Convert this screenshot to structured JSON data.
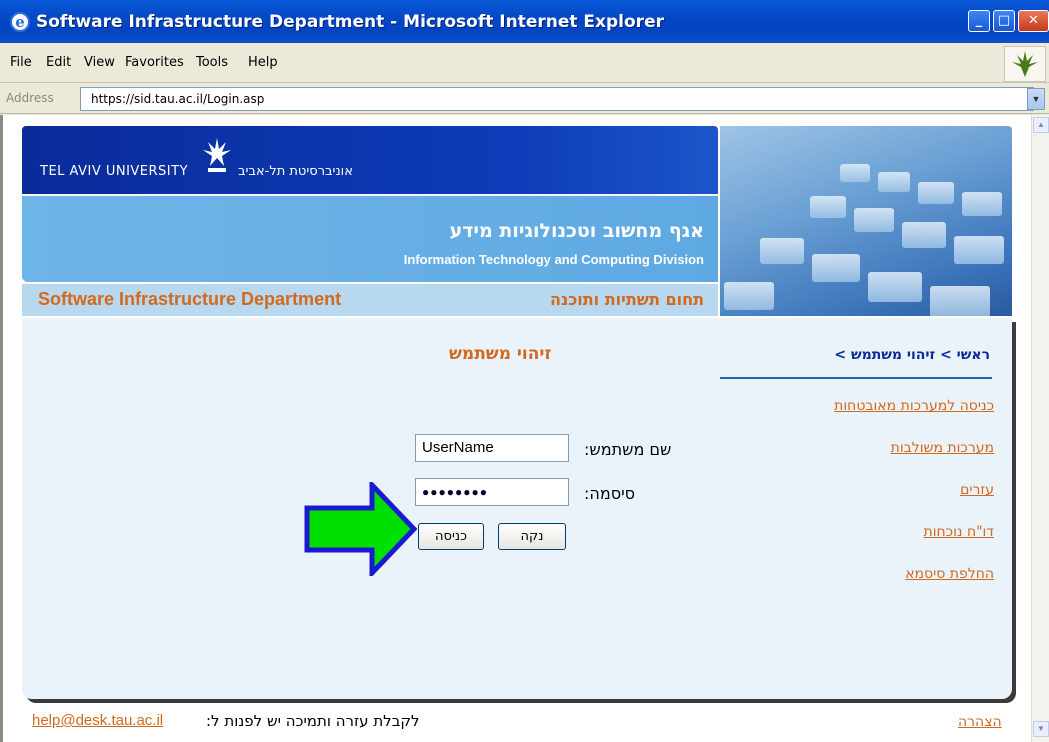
{
  "window": {
    "title": "Software Infrastructure Department - Microsoft Internet Explorer",
    "minimize": "_",
    "maximize": "□",
    "close": "✕"
  },
  "menu": [
    "File",
    "Edit",
    "View",
    "Favorites",
    "Tools",
    "Help"
  ],
  "address": {
    "label": "Address",
    "url": "https://sid.tau.ac.il/Login.asp"
  },
  "banner": {
    "university_en": "TEL AVIV UNIVERSITY",
    "university_he": "אוניברסיטת תל-אביב",
    "division_he": "אגף מחשוב וטכנולוגיות מידע",
    "division_en": "Information Technology and Computing Division",
    "department_en": "Software Infrastructure Department",
    "department_he": "תחום תשתיות ותוכנה"
  },
  "login": {
    "title": "זיהוי משתמש",
    "username_label": "שם משתמש:",
    "username_value": "UserName",
    "password_label": "סיסמה:",
    "password_value": "●●●●●●●●",
    "submit_label": "כניסה",
    "clear_label": "נקה"
  },
  "breadcrumb": "ראשי > זיהוי משתמש >",
  "side_links": [
    "כניסה למערכות מאובטחות",
    "מערכות משולבות",
    "עזרים",
    "דו\"ח נוכחות",
    "החלפת סיסמא"
  ],
  "footer": {
    "text": "לקבלת עזרה ותמיכה יש לפנות ל:",
    "email": "help@desk.tau.ac.il",
    "link": "הצהרה"
  },
  "colors": {
    "accent_orange": "#d2691e",
    "banner_blue": "#0a2b9a",
    "arrow_green": "#00e000",
    "arrow_border": "#1a1ad0"
  },
  "icons": {
    "app": "ie-icon",
    "brand": "tau-logo-icon",
    "arrow": "green-arrow-icon"
  }
}
